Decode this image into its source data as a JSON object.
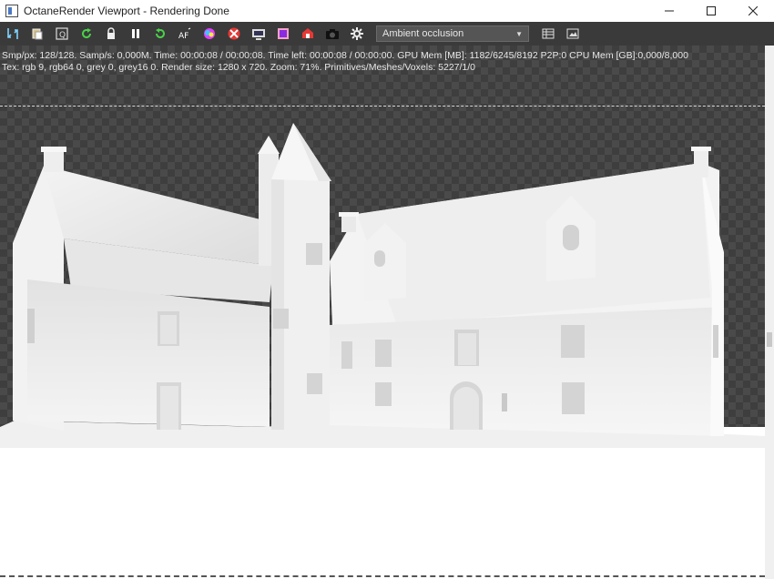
{
  "window": {
    "title": "OctaneRender Viewport - Rendering Done",
    "minimize_icon": "minimize-icon",
    "maximize_icon": "maximize-icon",
    "close_icon": "close-icon"
  },
  "toolbar": {
    "buttons": [
      "save-render-icon",
      "copy-clipboard-icon",
      "region-render-icon",
      "restart-render-icon",
      "lock-icon",
      "pause-icon",
      "reset-icon",
      "autofocus-icon",
      "color-picker-icon",
      "clay-mode-icon",
      "render-passes-icon",
      "film-region-icon",
      "render-layer-icon",
      "camera-icon",
      "settings-gear-icon"
    ],
    "mode_value": "Ambient occlusion",
    "right_buttons": [
      "grid-view-icon",
      "image-view-icon"
    ]
  },
  "stats": {
    "line1": "Smp/px: 128/128.   Samp/s: 0,000M.   Time: 00:00:08 / 00:00:08.   Time left: 00:00:08 / 00:00:00.   GPU Mem [MB]: 1182/6245/8192 P2P:0   CPU Mem [GB]:0,000/8,000",
    "line2": "Tex: rgb 9, rgb64 0, grey 0, grey16 0.   Render size: 1280 x 720.   Zoom: 71%.   Primitives/Meshes/Voxels: 5227/1/0"
  },
  "colors": {
    "toolbar_bg": "#3a3a3a",
    "viewport_checker_dark": "#3e3e3e",
    "viewport_checker_light": "#4a4a4a",
    "stats_text": "#e8e8e8"
  }
}
